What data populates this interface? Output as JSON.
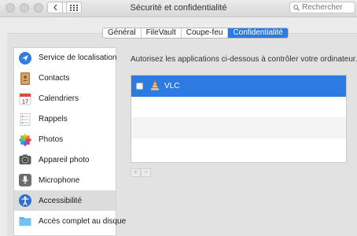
{
  "window": {
    "title": "Sécurité et confidentialité",
    "search_placeholder": "Rechercher"
  },
  "tabs": [
    {
      "label": "Général",
      "active": false
    },
    {
      "label": "FileVault",
      "active": false
    },
    {
      "label": "Coupe-feu",
      "active": false
    },
    {
      "label": "Confidentialité",
      "active": true
    }
  ],
  "sidebar": {
    "items": [
      {
        "label": "Service de localisation",
        "icon": "location-arrow-icon"
      },
      {
        "label": "Contacts",
        "icon": "contacts-book-icon"
      },
      {
        "label": "Calendriers",
        "icon": "calendar-icon",
        "calendar_day": "17"
      },
      {
        "label": "Rappels",
        "icon": "reminders-list-icon"
      },
      {
        "label": "Photos",
        "icon": "photos-flower-icon"
      },
      {
        "label": "Appareil photo",
        "icon": "camera-icon"
      },
      {
        "label": "Microphone",
        "icon": "microphone-icon"
      },
      {
        "label": "Accessibilité",
        "icon": "accessibility-icon",
        "selected": true
      },
      {
        "label": "Accès complet au disque",
        "icon": "folder-icon"
      }
    ]
  },
  "main": {
    "description": "Autorisez les applications ci-dessous à contrôler votre ordinateur.",
    "apps": [
      {
        "name": "VLC",
        "icon": "vlc-cone-icon",
        "checked": false,
        "selected": true
      }
    ],
    "add_label": "+",
    "remove_label": "−"
  },
  "colors": {
    "accent": "#2d7be0",
    "vlc_orange": "#f08a1c"
  }
}
